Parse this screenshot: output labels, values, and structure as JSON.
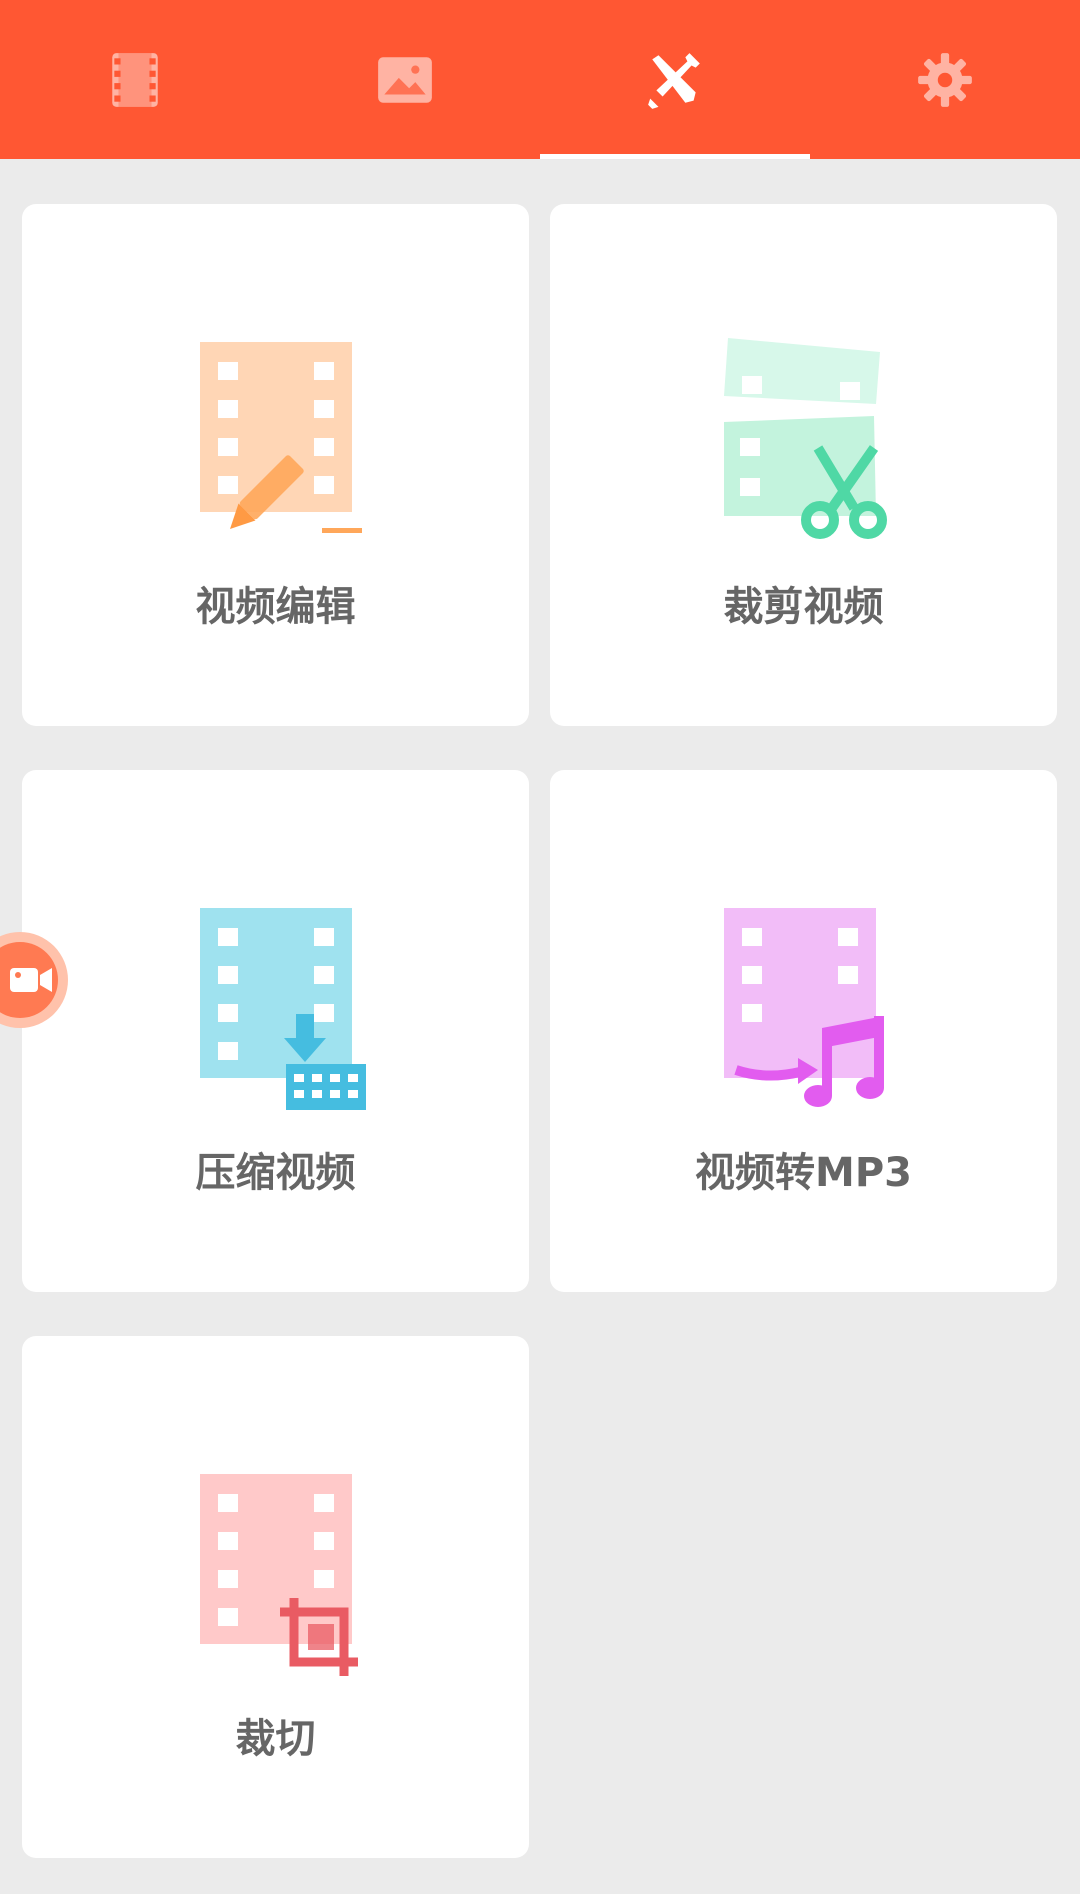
{
  "tabs": [
    {
      "icon": "film-icon",
      "active": false
    },
    {
      "icon": "image-icon",
      "active": false
    },
    {
      "icon": "tools-icon",
      "active": true
    },
    {
      "icon": "gear-icon",
      "active": false
    }
  ],
  "tools": [
    {
      "label": "视频编辑",
      "icon": "video-edit-icon",
      "color": "#ffcfa8",
      "accent": "#ffa75a"
    },
    {
      "label": "裁剪视频",
      "icon": "video-trim-icon",
      "color": "#c8f5e1",
      "accent": "#4fd8a5"
    },
    {
      "label": "压缩视频",
      "icon": "video-compress-icon",
      "color": "#8fdcec",
      "accent": "#45bde0"
    },
    {
      "label": "视频转MP3",
      "icon": "video-to-mp3-icon",
      "color": "#f0b3f7",
      "accent": "#e25cef"
    },
    {
      "label": "裁切",
      "icon": "video-crop-icon",
      "color": "#ffc3c3",
      "accent": "#e95b63"
    }
  ],
  "floating_button": {
    "icon": "video-camera-icon",
    "color": "#ff7a52"
  },
  "colors": {
    "topbar": "#ff5733",
    "background": "#ebebeb",
    "label": "#666666"
  }
}
